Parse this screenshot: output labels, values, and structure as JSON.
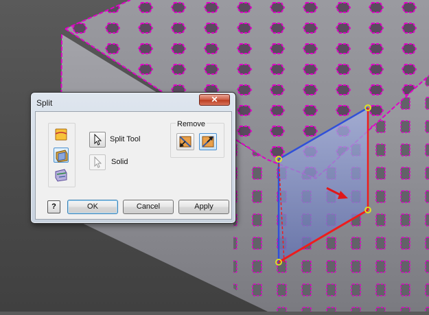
{
  "dialog": {
    "title": "Split",
    "close_symbol": "✕",
    "tool_buttons": [
      {
        "name": "split-face-icon",
        "active": false
      },
      {
        "name": "trim-solid-icon",
        "active": true
      },
      {
        "name": "split-solid-icon",
        "active": false
      }
    ],
    "split_tool_label": "Split Tool",
    "solid_label": "Solid",
    "remove_group_label": "Remove",
    "remove_buttons": [
      {
        "name": "remove-side-1-icon",
        "active": false
      },
      {
        "name": "remove-side-2-icon",
        "active": true
      }
    ],
    "help_label": "?",
    "ok_label": "OK",
    "cancel_label": "Cancel",
    "apply_label": "Apply"
  },
  "colors": {
    "part_edge": "#e000c8",
    "split_plane": "#7080c0",
    "red_edge": "#ee1c1c",
    "blue_edge": "#3050d8",
    "grip_point": "#e6e61a",
    "direction_arrow": "#e01818",
    "accent": "#3c7fb1"
  }
}
